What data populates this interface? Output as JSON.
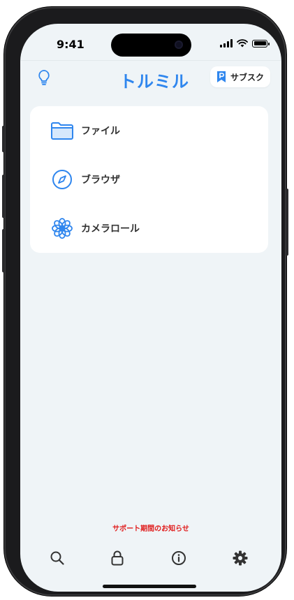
{
  "status_bar": {
    "time": "9:41"
  },
  "header": {
    "logo_text": "トルミル",
    "subscribe_label": "サブスク",
    "hint_icon": "lightbulb-icon",
    "subscribe_icon": "bookmark-p-icon"
  },
  "menu": {
    "items": [
      {
        "label": "ファイル",
        "icon": "folder-icon"
      },
      {
        "label": "ブラウザ",
        "icon": "compass-icon"
      },
      {
        "label": "カメラロール",
        "icon": "photos-flower-icon"
      }
    ]
  },
  "notice": {
    "text": "サポート期間のお知らせ"
  },
  "tabbar": {
    "items": [
      {
        "icon": "search-icon"
      },
      {
        "icon": "lock-icon"
      },
      {
        "icon": "info-icon"
      },
      {
        "icon": "gear-icon"
      }
    ]
  },
  "colors": {
    "accent": "#2f86ee",
    "background": "#eff4f7",
    "notice": "#e01b1b"
  }
}
